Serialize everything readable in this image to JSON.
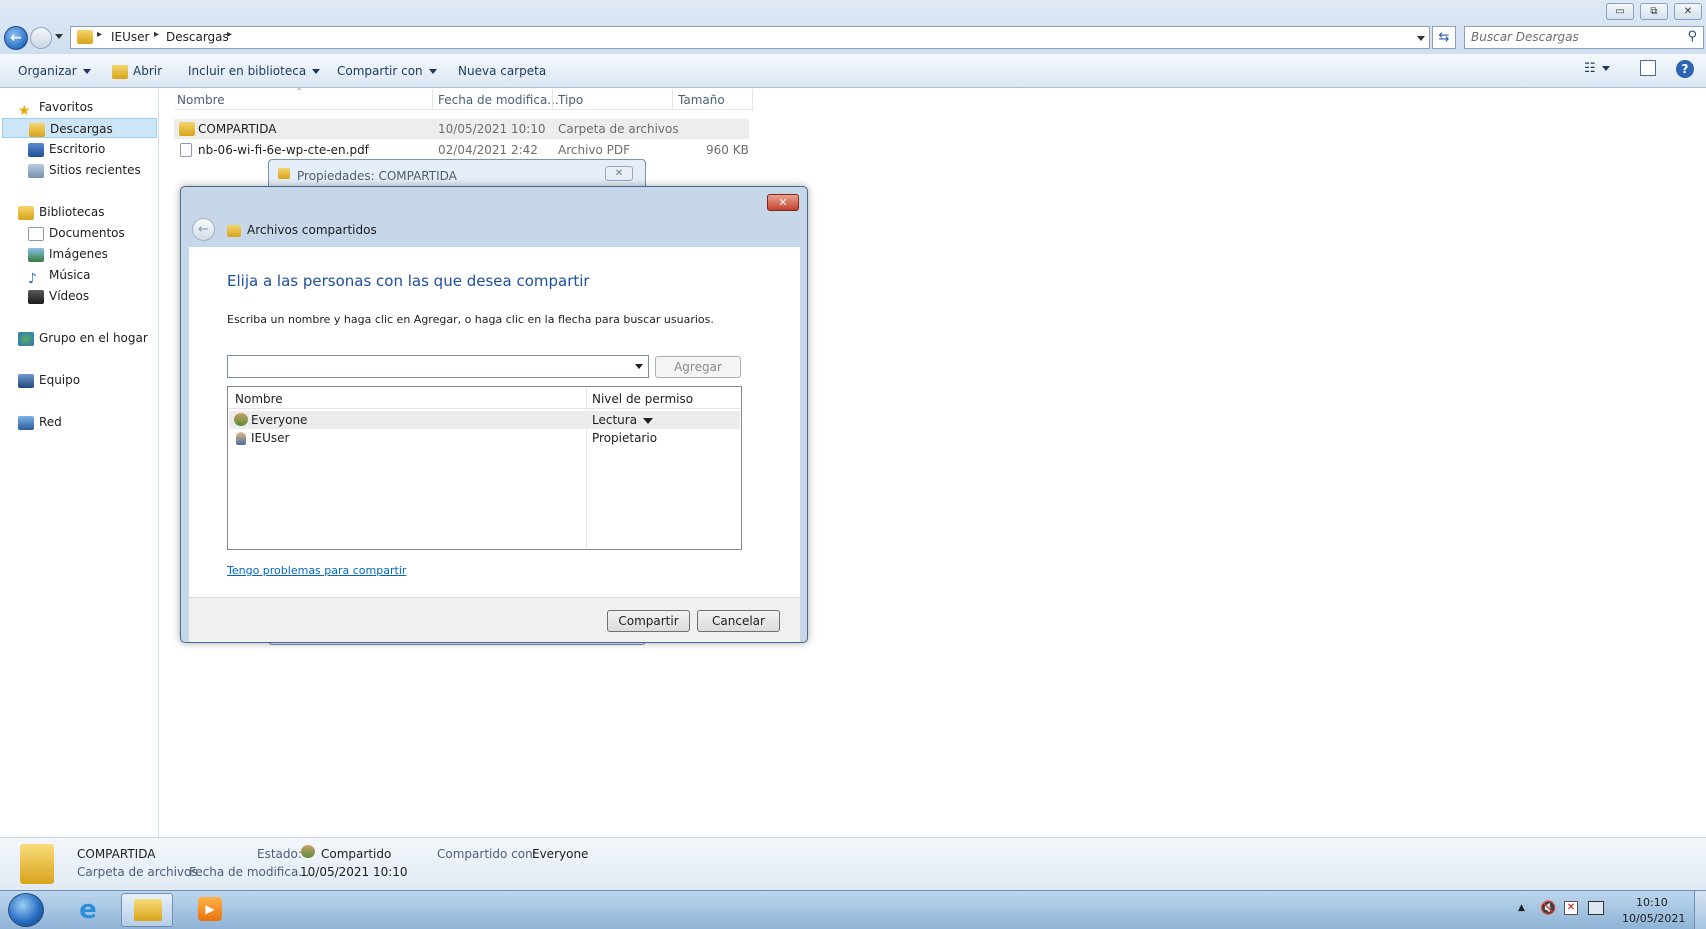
{
  "window": {
    "min_label": "▭",
    "max_label": "⧉",
    "close_label": "✕"
  },
  "address": {
    "crumbs": [
      "IEUser",
      "Descargas"
    ],
    "search_placeholder": "Buscar Descargas"
  },
  "toolbar": {
    "organize": "Organizar",
    "open": "Abrir",
    "include_library": "Incluir en biblioteca",
    "share_with": "Compartir con",
    "new_folder": "Nueva carpeta"
  },
  "sidebar": {
    "favorites": "Favoritos",
    "downloads": "Descargas",
    "desktop": "Escritorio",
    "recent": "Sitios recientes",
    "libraries": "Bibliotecas",
    "documents": "Documentos",
    "images": "Imágenes",
    "music": "Música",
    "videos": "Vídeos",
    "homegroup": "Grupo en el hogar",
    "computer": "Equipo",
    "network": "Red"
  },
  "filelist": {
    "columns": [
      "Nombre",
      "Fecha de modifica...",
      "Tipo",
      "Tamaño"
    ],
    "rows": [
      {
        "name": "COMPARTIDA",
        "date": "10/05/2021 10:10",
        "type": "Carpeta de archivos",
        "size": ""
      },
      {
        "name": "nb-06-wi-fi-6e-wp-cte-en.pdf",
        "date": "02/04/2021 2:42",
        "type": "Archivo PDF",
        "size": "960 KB"
      }
    ]
  },
  "props_window": {
    "title": "Propiedades: COMPARTIDA"
  },
  "dialog": {
    "title": "Archivos compartidos",
    "heading": "Elija a las personas con las que desea compartir",
    "instruction": "Escriba un nombre y haga clic en Agregar, o haga clic en la flecha para buscar usuarios.",
    "add_button": "Agregar",
    "table_headers": [
      "Nombre",
      "Nivel de permiso"
    ],
    "table_rows": [
      {
        "name": "Everyone",
        "permission": "Lectura"
      },
      {
        "name": "IEUser",
        "permission": "Propietario"
      }
    ],
    "help_link": "Tengo problemas para compartir",
    "share_button": "Compartir",
    "cancel_button": "Cancelar"
  },
  "details": {
    "name": "COMPARTIDA",
    "type": "Carpeta de archivos",
    "status_label": "Estado:",
    "status_value": "Compartido",
    "shared_label": "Compartido con:",
    "shared_value": "Everyone",
    "modified_label": "Fecha de modifica...",
    "modified_value": "10/05/2021 10:10"
  },
  "taskbar": {
    "time": "10:10",
    "date": "10/05/2021"
  }
}
